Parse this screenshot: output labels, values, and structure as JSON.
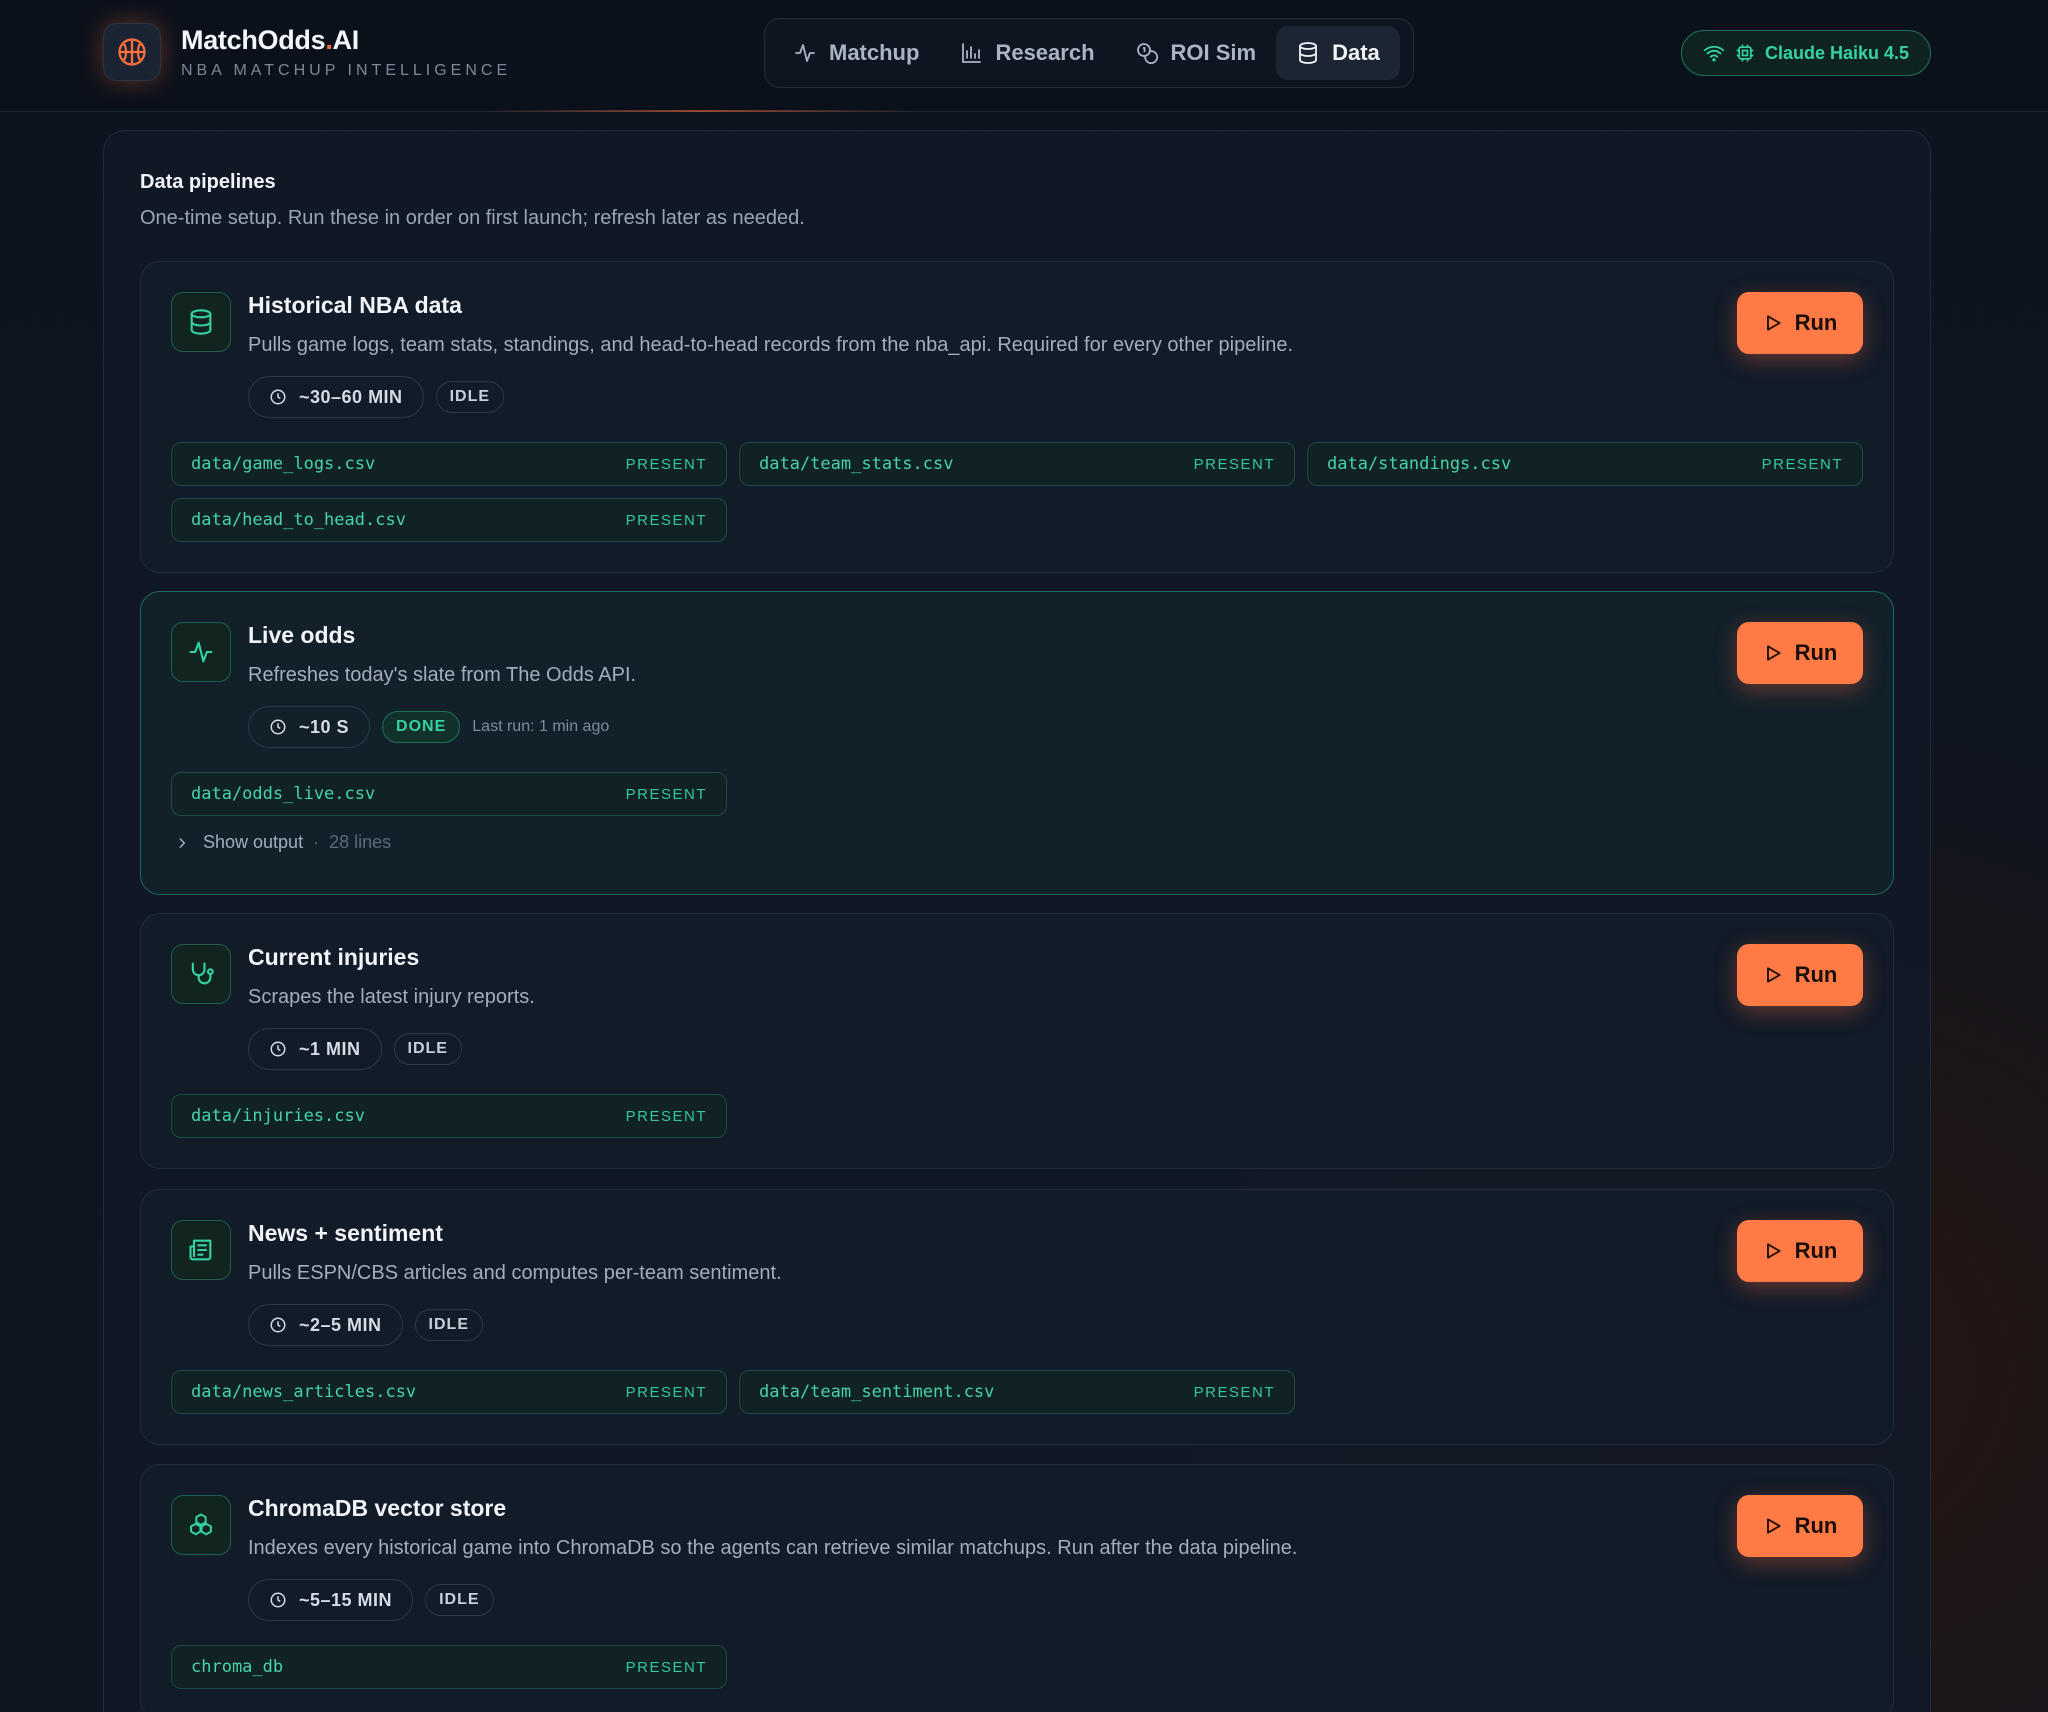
{
  "brand": {
    "name": "MatchOdds",
    "name_suffix": ".",
    "name_end": "AI",
    "subtitle": "NBA MATCHUP INTELLIGENCE"
  },
  "nav": {
    "items": [
      "Matchup",
      "Research",
      "ROI Sim",
      "Data"
    ],
    "active": "Data"
  },
  "model": {
    "label": "Claude Haiku 4.5"
  },
  "section": {
    "title": "Data pipelines",
    "description": "One-time setup. Run these in order on first launch; refresh later as needed."
  },
  "run_label": "Run",
  "pipelines": [
    {
      "title": "Historical NBA data",
      "description": "Pulls game logs, team stats, standings, and head-to-head records from the nba_api. Required for every other pipeline.",
      "time": "~30–60 MIN",
      "status": "IDLE",
      "icon": "database-icon",
      "files": [
        {
          "name": "data/game_logs.csv",
          "status": "PRESENT"
        },
        {
          "name": "data/team_stats.csv",
          "status": "PRESENT"
        },
        {
          "name": "data/standings.csv",
          "status": "PRESENT"
        },
        {
          "name": "data/head_to_head.csv",
          "status": "PRESENT"
        }
      ]
    },
    {
      "title": "Live odds",
      "description": "Refreshes today's slate from The Odds API.",
      "time": "~10 S",
      "status": "DONE",
      "last_run": "Last run: 1 min ago",
      "icon": "activity-icon",
      "files": [
        {
          "name": "data/odds_live.csv",
          "status": "PRESENT"
        }
      ],
      "output": {
        "label": "Show output",
        "sep": "·",
        "lines": "28 lines"
      }
    },
    {
      "title": "Current injuries",
      "description": "Scrapes the latest injury reports.",
      "time": "~1 MIN",
      "status": "IDLE",
      "icon": "stethoscope-icon",
      "files": [
        {
          "name": "data/injuries.csv",
          "status": "PRESENT"
        }
      ]
    },
    {
      "title": "News + sentiment",
      "description": "Pulls ESPN/CBS articles and computes per-team sentiment.",
      "time": "~2–5 MIN",
      "status": "IDLE",
      "icon": "newspaper-icon",
      "files": [
        {
          "name": "data/news_articles.csv",
          "status": "PRESENT"
        },
        {
          "name": "data/team_sentiment.csv",
          "status": "PRESENT"
        }
      ]
    },
    {
      "title": "ChromaDB vector store",
      "description": "Indexes every historical game into ChromaDB so the agents can retrieve similar matchups. Run after the data pipeline.",
      "time": "~5–15 MIN",
      "status": "IDLE",
      "icon": "boxes-icon",
      "files": [
        {
          "name": "chroma_db",
          "status": "PRESENT"
        }
      ]
    }
  ],
  "colors": {
    "accent": "#ff7a45",
    "success": "#34d3a4",
    "background": "#0d1420"
  }
}
